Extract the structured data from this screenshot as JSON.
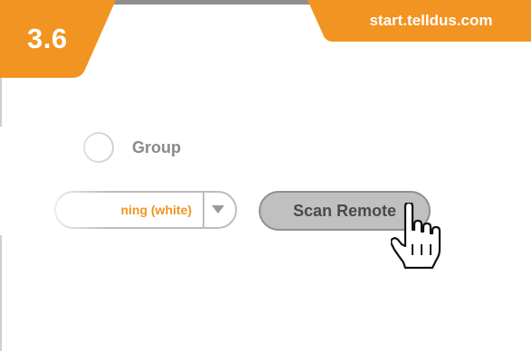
{
  "header": {
    "step_number": "3.6",
    "url": "start.telldus.com"
  },
  "form": {
    "group_label": "Group",
    "device_type_value": "ning (white)",
    "scan_button_label": "Scan Remote"
  },
  "icons": {
    "dropdown": "chevron-down-icon",
    "cursor": "hand-pointer-icon",
    "radio": "radio-circle-icon"
  },
  "colors": {
    "accent_orange": "#f29422",
    "button_gray": "#c0c0c0",
    "text_gray": "#8a8a8a"
  }
}
